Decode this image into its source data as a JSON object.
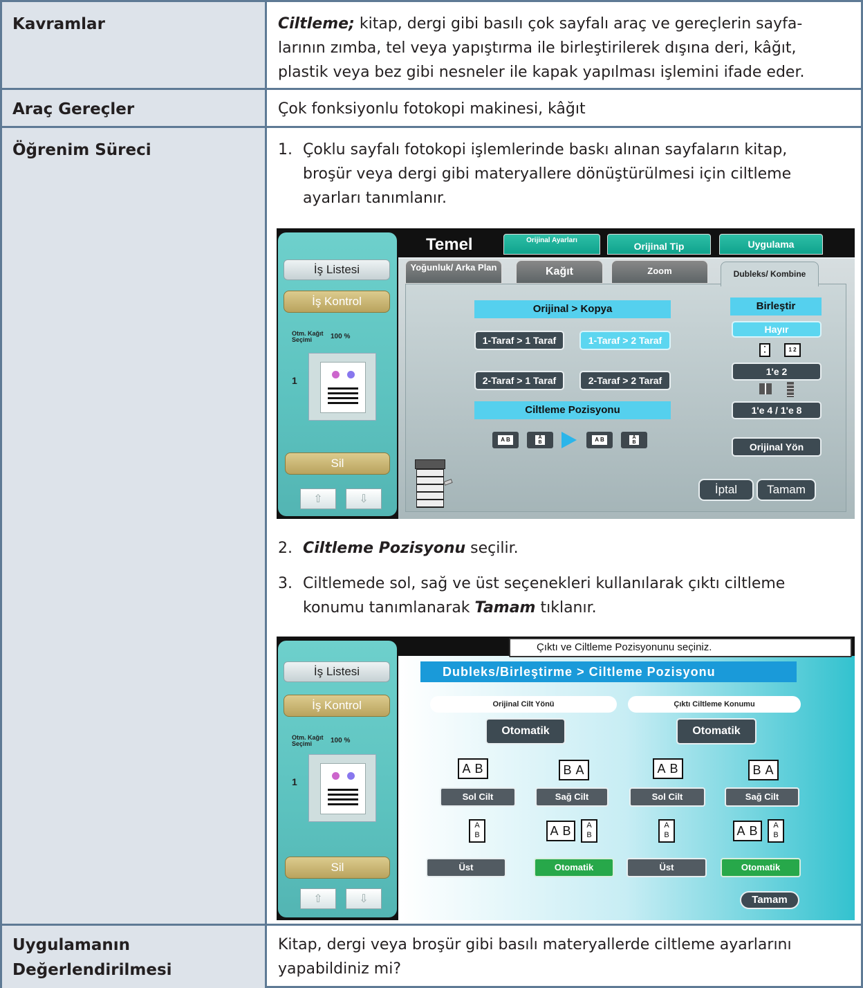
{
  "rows": [
    {
      "label": "Kavramlar",
      "term": "Ciltleme;",
      "definition_line1": " kitap, dergi gibi basılı çok sayfalı araç ve gereçlerin sayfa-",
      "definition_line2": "larının zımba, tel veya yapıştırma ile birleştirilerek dışına deri, kâğıt,",
      "definition_line3": "plastik veya bez gibi nesneler ile kapak yapılması işlemini ifade eder."
    },
    {
      "label": "Araç Gereçler",
      "text": "Çok fonksiyonlu fotokopi makinesi, kâğıt"
    },
    {
      "label": "Öğrenim Süreci",
      "step1_num": "1.",
      "step1_line1": "Çoklu sayfalı fotokopi işlemlerinde baskı alınan sayfaların kitap,",
      "step1_line2": "broşür veya dergi gibi materyallere dönüştürülmesi için ciltleme",
      "step1_line3": "ayarları tanımlanır.",
      "step2_num": "2.",
      "step2_bold": "Ciltleme Pozisyonu",
      "step2_rest": " seçilir.",
      "step3_num": "3.",
      "step3_line1": "Ciltlemede sol, sağ ve üst seçenekleri kullanılarak çıktı ciltleme",
      "step3_line2a": "konumu tanımlanarak ",
      "step3_bold": "Tamam",
      "step3_line2b": " tıklanır."
    },
    {
      "label_line1": "Uygulamanın",
      "label_line2": "Değerlendirilmesi",
      "line1": "Kitap, dergi veya broşür gibi basılı materyallerde ciltleme ayarlarını",
      "line2": "yapabildiniz mi?"
    }
  ],
  "screen1": {
    "side": {
      "job_list": "İş Listesi",
      "job_control": "İş Kontrol",
      "paper_select_line1": "Otm. Kağıt",
      "paper_select_line2": "Seçimi",
      "zoom": "100 %",
      "stack": "1",
      "delete": "Sil",
      "up": "⇧",
      "down": "⇩"
    },
    "title": "Temel",
    "top_tabs": [
      "Orijinal Ayarları",
      "Orijinal Tip",
      "Uygulama"
    ],
    "tabs": [
      "Yoğunluk/ Arka Plan",
      "Kağıt",
      "Zoom",
      "Dubleks/ Kombine"
    ],
    "original_copy_bar": "Orijinal > Kopya",
    "duplex_buttons": [
      "1-Taraf > 1 Taraf",
      "1-Taraf > 2 Taraf",
      "2-Taraf > 1 Taraf",
      "2-Taraf > 2 Taraf"
    ],
    "binding_bar": "Ciltleme Pozisyonu",
    "binding_icons": [
      "A B",
      "A B"
    ],
    "combine_bar": "Birleştir",
    "combine_no": "Hayır",
    "combine_icon_label": "1 2",
    "combine_1e2": "1'e 2",
    "combine_1e4": "1'e 4 / 1'e 8",
    "original_direction": "Orijinal Yön",
    "cancel": "İptal",
    "ok": "Tamam",
    "accent": "#55d0ee"
  },
  "screen2": {
    "side": {
      "job_list": "İş Listesi",
      "job_control": "İş Kontrol",
      "paper_select_line1": "Otm. Kağıt",
      "paper_select_line2": "Seçimi",
      "zoom": "100 %",
      "stack": "1",
      "delete": "Sil",
      "up": "⇧",
      "down": "⇩"
    },
    "message": "Çıktı ve Ciltleme Pozisyonunu seçiniz.",
    "header": "Dubleks/Birleştirme > Ciltleme Pozisyonu",
    "left_group": "Orijinal Cilt Yönü",
    "right_group": "Çıktı Ciltleme Konumu",
    "auto": "Otomatik",
    "book_ab": "A B",
    "book_ba": "B A",
    "left_bind": "Sol Cilt",
    "right_bind": "Sağ Cilt",
    "top_bind": "Üst",
    "auto_small": "Otomatik",
    "ok": "Tamam",
    "green": "#27a84a"
  }
}
